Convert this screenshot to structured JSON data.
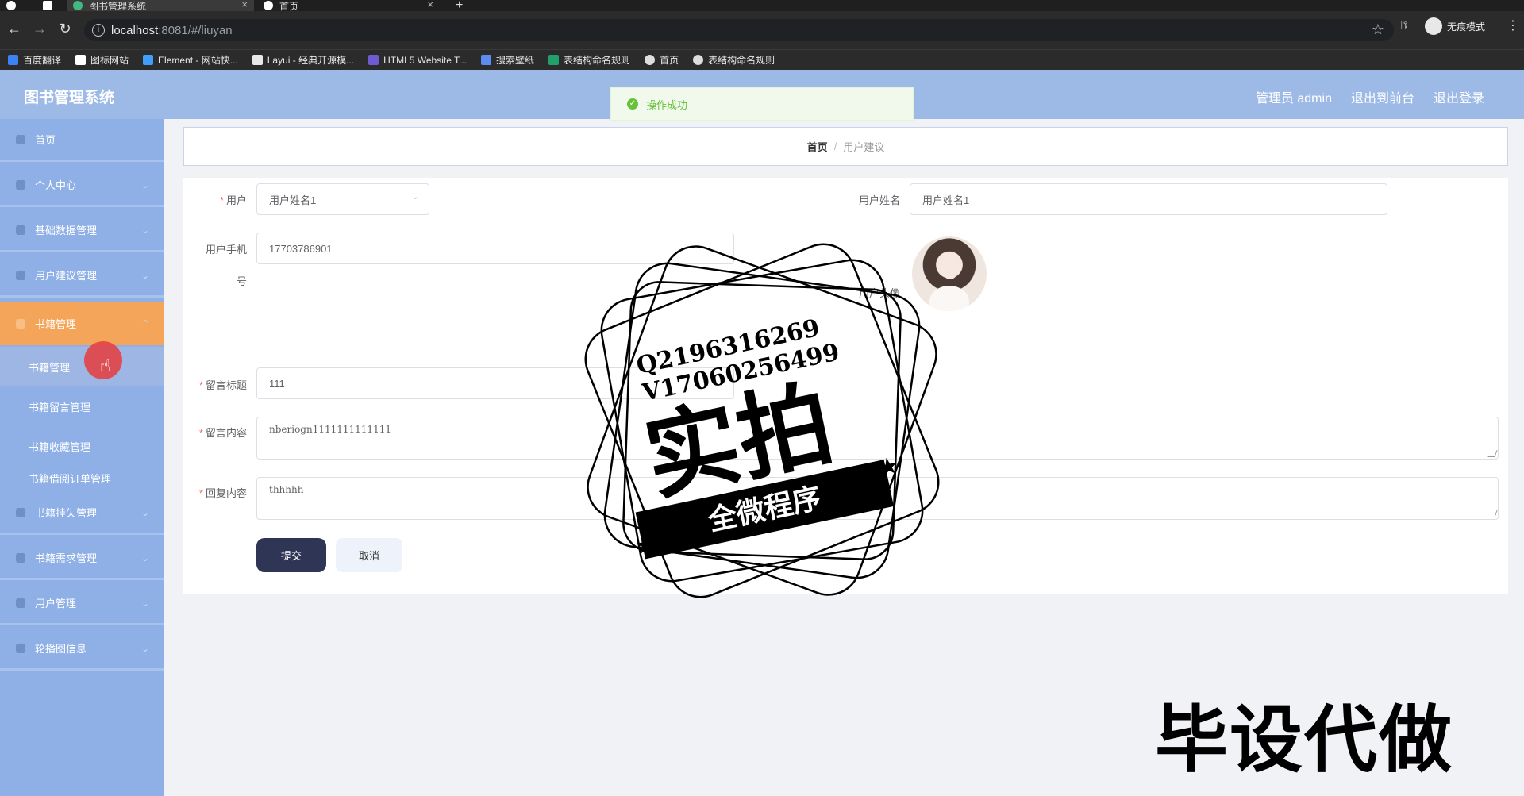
{
  "browser": {
    "tabs": [
      {
        "title": "图书管理系统",
        "active": true
      },
      {
        "title": "首页",
        "active": false
      }
    ],
    "url_host": "localhost",
    "url_rest": ":8081/#/liuyan",
    "incognito_label": "无痕模式",
    "bookmarks": [
      {
        "label": "百度翻译",
        "color": "#3b82f6"
      },
      {
        "label": "图标网站",
        "color": "#ffffff"
      },
      {
        "label": "Element - 网站快...",
        "color": "#409eff"
      },
      {
        "label": "Layui - 经典开源模...",
        "color": "#e8e8e8"
      },
      {
        "label": "HTML5 Website T...",
        "color": "#6d5bd0"
      },
      {
        "label": "搜索壁纸",
        "color": "#5b8def"
      },
      {
        "label": "表结构命名规则",
        "color": "#22a06b"
      },
      {
        "label": "首页",
        "color": "#dddddd"
      },
      {
        "label": "表结构命名规则",
        "color": "#dddddd"
      }
    ]
  },
  "header": {
    "title": "图书管理系统",
    "links": [
      "管理员 admin",
      "退出到前台",
      "退出登录"
    ]
  },
  "toast": {
    "message": "操作成功"
  },
  "sidebar": {
    "items": [
      {
        "label": "首页"
      },
      {
        "label": "个人中心"
      },
      {
        "label": "基础数据管理"
      },
      {
        "label": "用户建议管理"
      },
      {
        "label": "书籍管理"
      }
    ],
    "sub_items": [
      {
        "label": "书籍管理"
      },
      {
        "label": "书籍留言管理"
      },
      {
        "label": "书籍收藏管理"
      },
      {
        "label": "书籍借阅订单管理"
      }
    ],
    "items_after": [
      {
        "label": "书籍挂失管理"
      },
      {
        "label": "书籍需求管理"
      },
      {
        "label": "用户管理"
      },
      {
        "label": "轮播图信息"
      }
    ]
  },
  "breadcrumb": {
    "home": "首页",
    "current": "用户建议"
  },
  "form": {
    "user_label": "用户",
    "user_value": "用户姓名1",
    "username_label": "用户姓名",
    "username_value": "用户姓名1",
    "phone_label_1": "用户手机",
    "phone_label_2": "号",
    "phone_value": "17703786901",
    "avatar_label": "用户头像",
    "title_label": "留言标题",
    "title_value": "111",
    "content_label": "留言内容",
    "content_value": "nberiogn1111111111111",
    "reply_label": "回复内容",
    "reply_value": "thhhhh",
    "submit_label": "提交",
    "cancel_label": "取消"
  },
  "watermark": {
    "line1": "Q2196316269",
    "line2": "V17060256499",
    "big": "实拍",
    "ribbon": "全微程序",
    "corner": "毕设代做"
  }
}
